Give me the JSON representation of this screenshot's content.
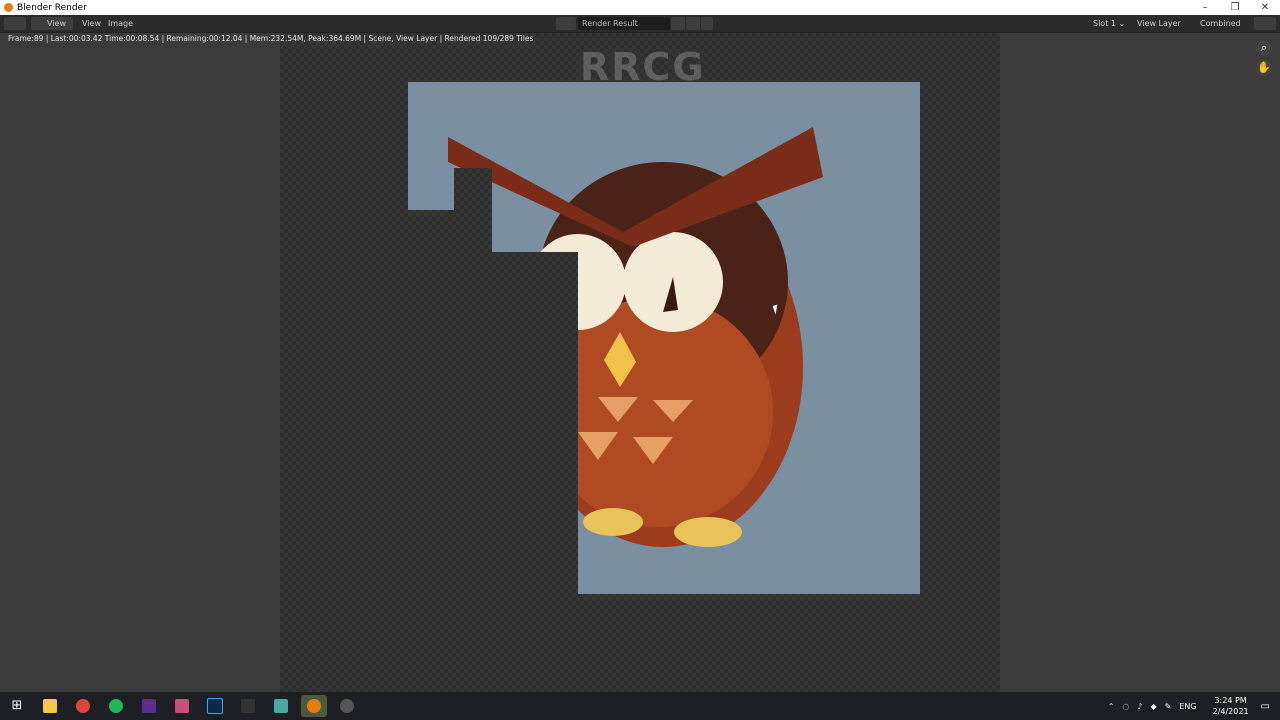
{
  "window": {
    "title": "Blender Render"
  },
  "header": {
    "view_label": "View",
    "view2_label": "View",
    "image_label": "Image",
    "image_name": "Render Result",
    "slot": "Slot 1",
    "view_layer": "View Layer",
    "pass": "Combined"
  },
  "status_text": "Frame:89 | Last:00:03.42 Time:00:08.54 | Remaining:00:12.04 | Mem:232.54M, Peak:364.69M | Scene, View Layer | Rendered 109/289 Tiles",
  "watermark": "RRCG",
  "taskbar": {
    "tray_lang": "ENG",
    "time": "3:24 PM",
    "date": "2/4/2021"
  }
}
